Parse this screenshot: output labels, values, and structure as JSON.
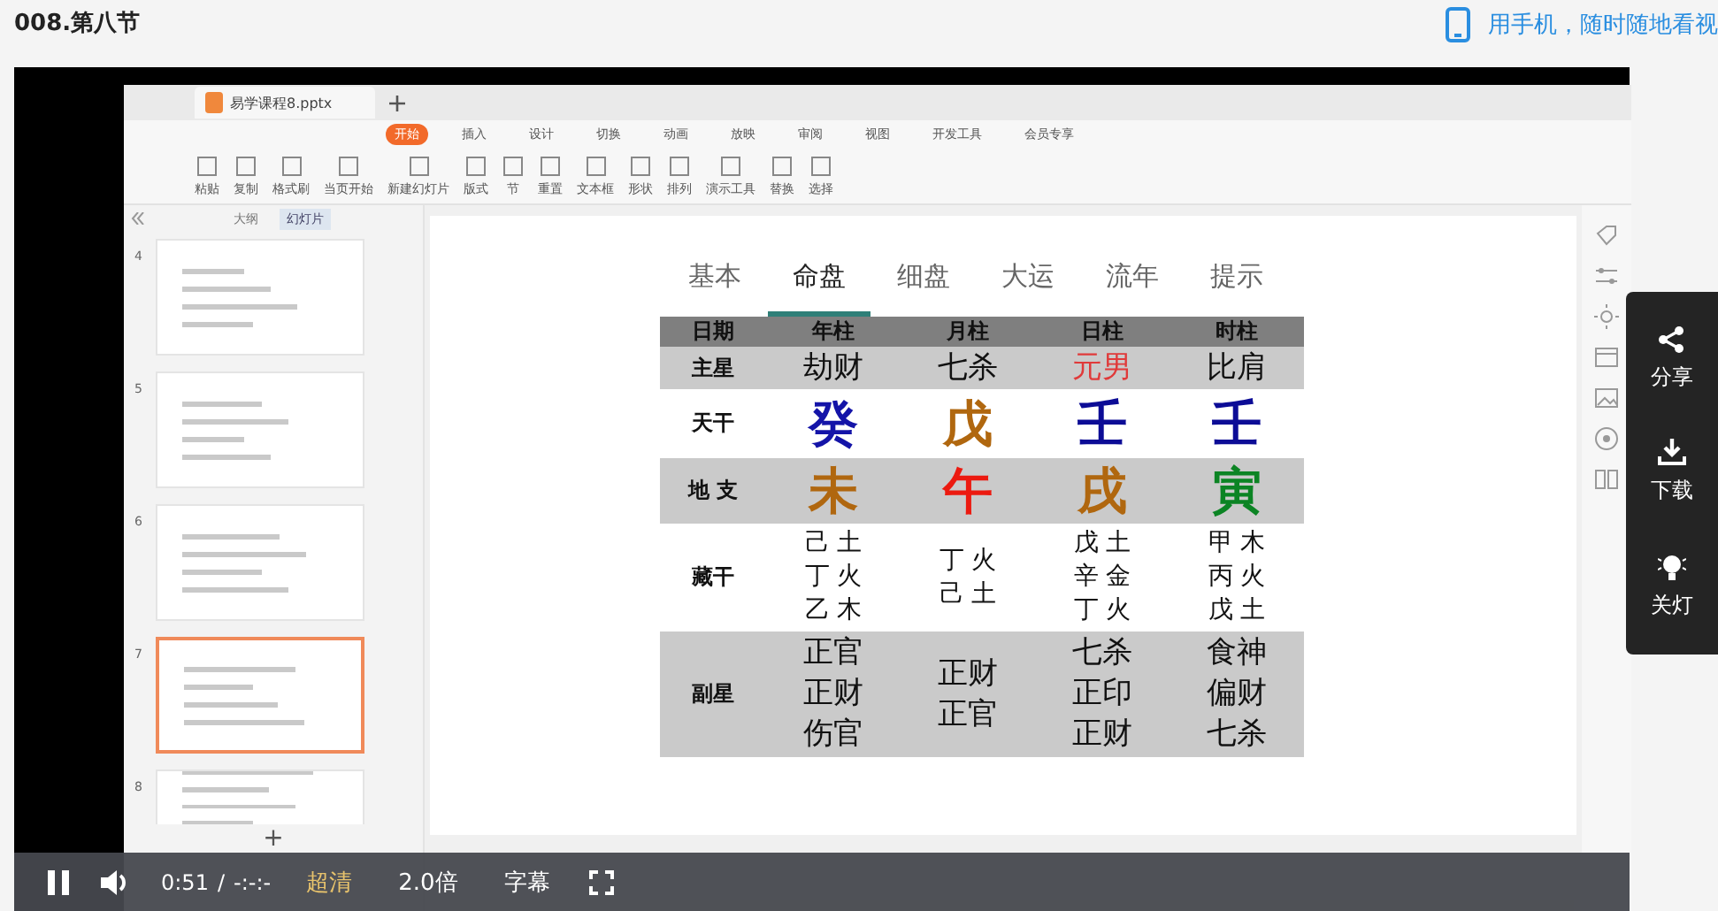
{
  "page": {
    "title": "008.第八节",
    "mobile_link": "用手机，随时随地看视"
  },
  "app": {
    "file_tab": "易学课程8.pptx",
    "ribbon_tabs": [
      {
        "label": "开始",
        "selected": true
      },
      {
        "label": "插入",
        "selected": false
      },
      {
        "label": "设计",
        "selected": false
      },
      {
        "label": "切换",
        "selected": false
      },
      {
        "label": "动画",
        "selected": false
      },
      {
        "label": "放映",
        "selected": false
      },
      {
        "label": "审阅",
        "selected": false
      },
      {
        "label": "视图",
        "selected": false
      },
      {
        "label": "开发工具",
        "selected": false
      },
      {
        "label": "会员专享",
        "selected": false
      }
    ],
    "ribbon_tools": [
      "粘贴",
      "复制",
      "格式刷",
      "当页开始",
      "新建幻灯片",
      "版式",
      "节",
      "重置",
      "文本框",
      "形状",
      "排列",
      "演示工具",
      "替换",
      "选择"
    ],
    "panel_tabs": [
      {
        "label": "大纲",
        "selected": false
      },
      {
        "label": "幻灯片",
        "selected": true
      }
    ],
    "add_slide": "+",
    "slides": [
      {
        "number": "4",
        "selected": false
      },
      {
        "number": "5",
        "selected": false
      },
      {
        "number": "6",
        "selected": false
      },
      {
        "number": "7",
        "selected": true
      },
      {
        "number": "8",
        "selected": false
      }
    ],
    "slide": {
      "tabs": [
        {
          "label": "基本",
          "selected": false
        },
        {
          "label": "命盘",
          "selected": true
        },
        {
          "label": "细盘",
          "selected": false
        },
        {
          "label": "大运",
          "selected": false
        },
        {
          "label": "流年",
          "selected": false
        },
        {
          "label": "提示",
          "selected": false
        }
      ],
      "table": {
        "columns": [
          "日期",
          "年柱",
          "月柱",
          "日柱",
          "时柱"
        ],
        "rows": [
          {
            "kind": "star",
            "cells": [
              {
                "lines": [
                  "主星"
                ]
              },
              {
                "lines": [
                  "劫财"
                ]
              },
              {
                "lines": [
                  "七杀"
                ]
              },
              {
                "lines": [
                  "元男"
                ],
                "color": "#e03a3a"
              },
              {
                "lines": [
                  "比肩"
                ]
              }
            ]
          },
          {
            "kind": "stem",
            "cells": [
              {
                "lines": [
                  "天干"
                ]
              },
              {
                "lines": [
                  "癸"
                ],
                "color": "#1414a8"
              },
              {
                "lines": [
                  "戊"
                ],
                "color": "#b0670f"
              },
              {
                "lines": [
                  "壬"
                ],
                "color": "#0c0c96"
              },
              {
                "lines": [
                  "壬"
                ],
                "color": "#0c0c96"
              }
            ]
          },
          {
            "kind": "branch",
            "cells": [
              {
                "lines": [
                  "地 支"
                ]
              },
              {
                "lines": [
                  "未"
                ],
                "color": "#b0670f"
              },
              {
                "lines": [
                  "午"
                ],
                "color": "#ec1a10"
              },
              {
                "lines": [
                  "戌"
                ],
                "color": "#b0670f"
              },
              {
                "lines": [
                  "寅"
                ],
                "color": "#0c8424"
              }
            ]
          },
          {
            "kind": "hidden",
            "cells": [
              {
                "lines": [
                  "藏干"
                ]
              },
              {
                "lines": [
                  "己 土",
                  "丁 火",
                  "乙 木"
                ]
              },
              {
                "lines": [
                  "丁 火",
                  "己 土"
                ]
              },
              {
                "lines": [
                  "戊 土",
                  "辛 金",
                  "丁 火"
                ]
              },
              {
                "lines": [
                  "甲 木",
                  "丙 火",
                  "戊 土"
                ]
              }
            ]
          },
          {
            "kind": "aux",
            "cells": [
              {
                "lines": [
                  "副星"
                ]
              },
              {
                "lines": [
                  "正官",
                  "正财",
                  "伤官"
                ]
              },
              {
                "lines": [
                  "正财",
                  "正官"
                ]
              },
              {
                "lines": [
                  "七杀",
                  "正印",
                  "正财"
                ]
              },
              {
                "lines": [
                  "食神",
                  "偏财",
                  "七杀"
                ]
              }
            ]
          }
        ]
      }
    }
  },
  "player": {
    "playing": true,
    "time": "0:51",
    "separator": "/",
    "duration": "-:-:-",
    "quality": "超清",
    "speed": "2.0倍",
    "subtitles": "字幕"
  },
  "side_panel": [
    {
      "kind": "share",
      "label": "分享"
    },
    {
      "kind": "download",
      "label": "下载"
    },
    {
      "kind": "light",
      "label": "关灯"
    }
  ]
}
